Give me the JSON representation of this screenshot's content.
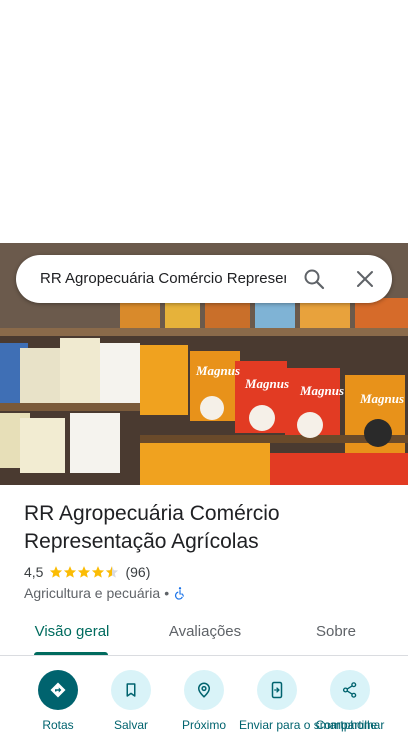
{
  "search": {
    "query": "RR Agropecuária Comércio Representação Agrícolas"
  },
  "place": {
    "title": "RR Agropecuária Comércio Representação Agrícolas",
    "rating_value": "4,5",
    "rating_stars": 4.5,
    "review_count": "(96)",
    "category": "Agricultura e pecuária",
    "separator": "•"
  },
  "hero_image": {
    "brand_text": "Magnus"
  },
  "tabs": [
    {
      "label": "Visão geral",
      "active": true
    },
    {
      "label": "Avaliações",
      "active": false
    },
    {
      "label": "Sobre",
      "active": false
    }
  ],
  "actions": [
    {
      "label": "Rotas",
      "icon": "directions-icon"
    },
    {
      "label": "Salvar",
      "icon": "bookmark-icon"
    },
    {
      "label": "Próximo",
      "icon": "nearby-icon"
    },
    {
      "label": "Enviar para o smartphone",
      "icon": "send-to-phone-icon"
    },
    {
      "label": "Compartilhar",
      "icon": "share-icon"
    }
  ],
  "colors": {
    "accent": "#006b5e",
    "action_bg": "#d9f3f8",
    "star": "#fbbc04"
  }
}
